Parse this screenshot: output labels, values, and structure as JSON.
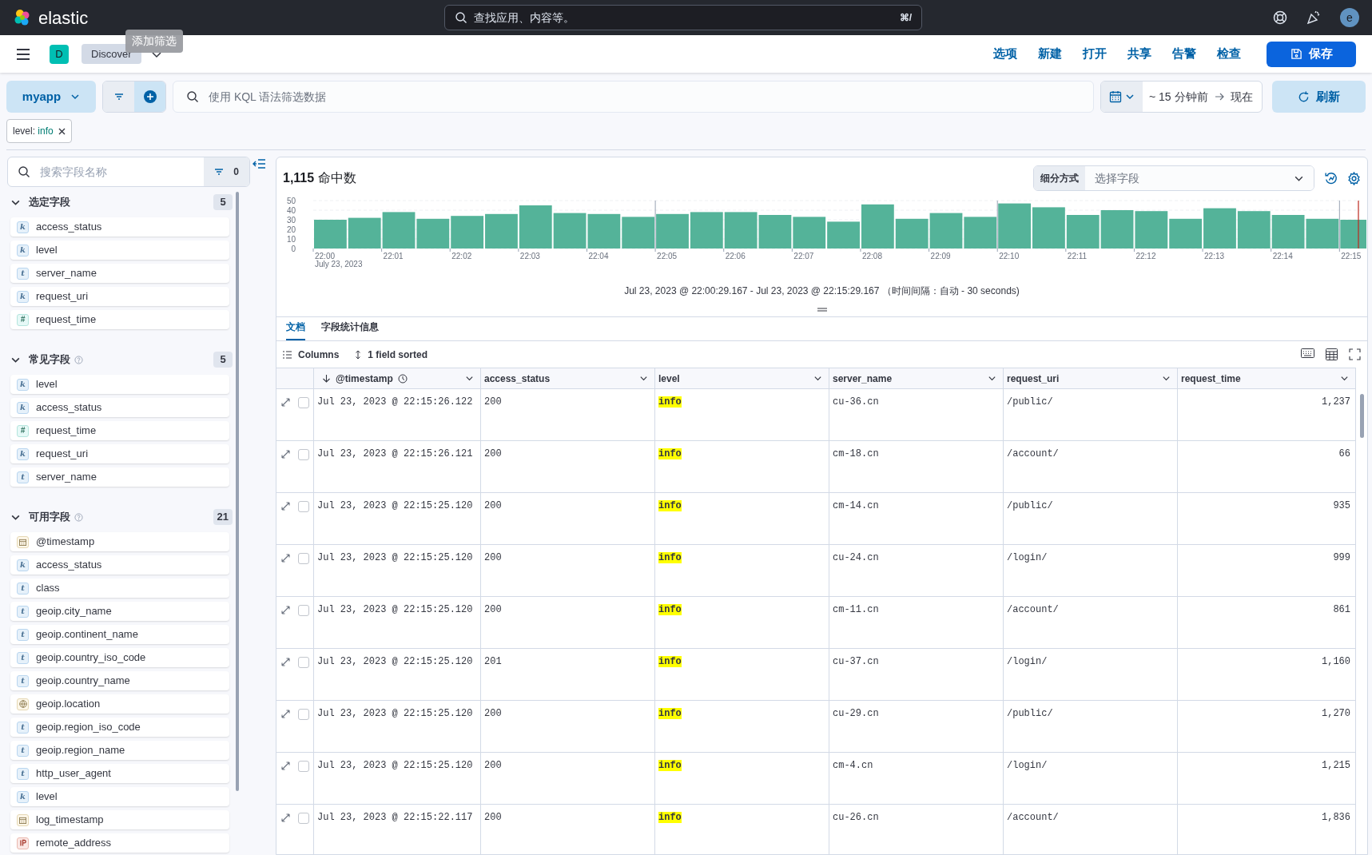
{
  "header": {
    "logo_text": "elastic",
    "search": {
      "placeholder": "查找应用、内容等。",
      "shortcut": "⌘/"
    },
    "avatar": "e"
  },
  "nav": {
    "app_badge": "D",
    "breadcrumb": "Discover",
    "tooltip": "添加筛选",
    "links": [
      "选项",
      "新建",
      "打开",
      "共享",
      "告警",
      "检查"
    ],
    "save_button": "保存"
  },
  "query_bar": {
    "data_view": "myapp",
    "placeholder": "使用 KQL 语法筛选数据",
    "time_from": "~ 15 分钟前",
    "time_to": "现在",
    "refresh_button": "刷新"
  },
  "filters": [
    {
      "field": "level:",
      "value": "info"
    }
  ],
  "sidebar": {
    "search": {
      "placeholder": "搜索字段名称"
    },
    "filter_count": "0",
    "sections": [
      {
        "title": "选定字段",
        "count": "5",
        "info_icon": false,
        "expanded": true,
        "fields": [
          {
            "kind": "keyword",
            "type_icon": "k",
            "name": "access_status"
          },
          {
            "kind": "keyword",
            "type_icon": "k",
            "name": "level"
          },
          {
            "kind": "text",
            "type_icon": "t",
            "name": "server_name"
          },
          {
            "kind": "keyword",
            "type_icon": "k",
            "name": "request_uri"
          },
          {
            "kind": "number",
            "type_icon": "#",
            "name": "request_time"
          }
        ]
      },
      {
        "title": "常见字段",
        "count": "5",
        "info_icon": true,
        "expanded": true,
        "fields": [
          {
            "kind": "keyword",
            "type_icon": "k",
            "name": "level"
          },
          {
            "kind": "keyword",
            "type_icon": "k",
            "name": "access_status"
          },
          {
            "kind": "number",
            "type_icon": "#",
            "name": "request_time"
          },
          {
            "kind": "keyword",
            "type_icon": "k",
            "name": "request_uri"
          },
          {
            "kind": "text",
            "type_icon": "t",
            "name": "server_name"
          }
        ]
      },
      {
        "title": "可用字段",
        "count": "21",
        "info_icon": true,
        "expanded": true,
        "fields": [
          {
            "kind": "date",
            "name": "@timestamp"
          },
          {
            "kind": "keyword",
            "type_icon": "k",
            "name": "access_status"
          },
          {
            "kind": "text",
            "type_icon": "t",
            "name": "class"
          },
          {
            "kind": "text",
            "type_icon": "t",
            "name": "geoip.city_name"
          },
          {
            "kind": "text",
            "type_icon": "t",
            "name": "geoip.continent_name"
          },
          {
            "kind": "text",
            "type_icon": "t",
            "name": "geoip.country_iso_code"
          },
          {
            "kind": "text",
            "type_icon": "t",
            "name": "geoip.country_name"
          },
          {
            "kind": "geo",
            "name": "geoip.location"
          },
          {
            "kind": "text",
            "type_icon": "t",
            "name": "geoip.region_iso_code"
          },
          {
            "kind": "text",
            "type_icon": "t",
            "name": "geoip.region_name"
          },
          {
            "kind": "text",
            "type_icon": "t",
            "name": "http_user_agent"
          },
          {
            "kind": "keyword",
            "type_icon": "k",
            "name": "level"
          },
          {
            "kind": "date",
            "name": "log_timestamp"
          },
          {
            "kind": "ip",
            "name": "remote_address"
          }
        ]
      }
    ]
  },
  "hits": {
    "count": "1,115",
    "label": "命中数",
    "breakdown_label": "细分方式",
    "breakdown_placeholder": "选择字段"
  },
  "chart_data": {
    "type": "bar",
    "categories": [
      "22:00",
      null,
      "22:01",
      null,
      "22:02",
      null,
      "22:03",
      null,
      "22:04",
      null,
      "22:05",
      null,
      "22:06",
      null,
      "22:07",
      null,
      "22:08",
      null,
      "22:09",
      null,
      "22:10",
      null,
      "22:11",
      null,
      "22:12",
      null,
      "22:13",
      null,
      "22:14",
      null,
      "22:15"
    ],
    "series": [
      {
        "color": "#54b399",
        "values": [
          30,
          32,
          38,
          31,
          34,
          36,
          45,
          37,
          36,
          33,
          36,
          38,
          38,
          35,
          33,
          28,
          46,
          31,
          37,
          33,
          47,
          43,
          35,
          40,
          39,
          31,
          42,
          39,
          35,
          31,
          30
        ]
      }
    ],
    "ylim": [
      0,
      50
    ],
    "yticks": [
      0,
      10,
      20,
      30,
      40,
      50
    ],
    "grid": true,
    "annotations": [
      "July 23, 2023"
    ]
  },
  "time_range": "Jul 23, 2023 @ 22:00:29.167 - Jul 23, 2023 @ 22:15:29.167 （时间间隔：自动 - 30 seconds)",
  "tabs": [
    {
      "label": "文档",
      "selected": true
    },
    {
      "label": "字段统计信息",
      "selected": false
    }
  ],
  "table_toolbar": {
    "columns_button": "Columns",
    "sort_button": "1 field sorted"
  },
  "table": {
    "columns": [
      "@timestamp",
      "access_status",
      "level",
      "server_name",
      "request_uri",
      "request_time"
    ],
    "rows": [
      {
        "checked": false,
        "cells": [
          "Jul 23, 2023 @ 22:15:26.122",
          "200",
          "info",
          "cu-36.cn",
          "/public/",
          "1,237"
        ]
      },
      {
        "checked": false,
        "cells": [
          "Jul 23, 2023 @ 22:15:26.121",
          "200",
          "info",
          "cm-18.cn",
          "/account/",
          "66"
        ]
      },
      {
        "checked": false,
        "cells": [
          "Jul 23, 2023 @ 22:15:25.120",
          "200",
          "info",
          "cm-14.cn",
          "/public/",
          "935"
        ]
      },
      {
        "checked": false,
        "cells": [
          "Jul 23, 2023 @ 22:15:25.120",
          "200",
          "info",
          "cu-24.cn",
          "/login/",
          "999"
        ]
      },
      {
        "checked": false,
        "cells": [
          "Jul 23, 2023 @ 22:15:25.120",
          "200",
          "info",
          "cm-11.cn",
          "/account/",
          "861"
        ]
      },
      {
        "checked": false,
        "cells": [
          "Jul 23, 2023 @ 22:15:25.120",
          "201",
          "info",
          "cu-37.cn",
          "/login/",
          "1,160"
        ]
      },
      {
        "checked": false,
        "cells": [
          "Jul 23, 2023 @ 22:15:25.120",
          "200",
          "info",
          "cu-29.cn",
          "/public/",
          "1,270"
        ]
      },
      {
        "checked": false,
        "cells": [
          "Jul 23, 2023 @ 22:15:25.120",
          "200",
          "info",
          "cm-4.cn",
          "/login/",
          "1,215"
        ]
      },
      {
        "checked": false,
        "cells": [
          "Jul 23, 2023 @ 22:15:22.117",
          "200",
          "info",
          "cu-26.cn",
          "/account/",
          "1,836"
        ]
      }
    ]
  }
}
